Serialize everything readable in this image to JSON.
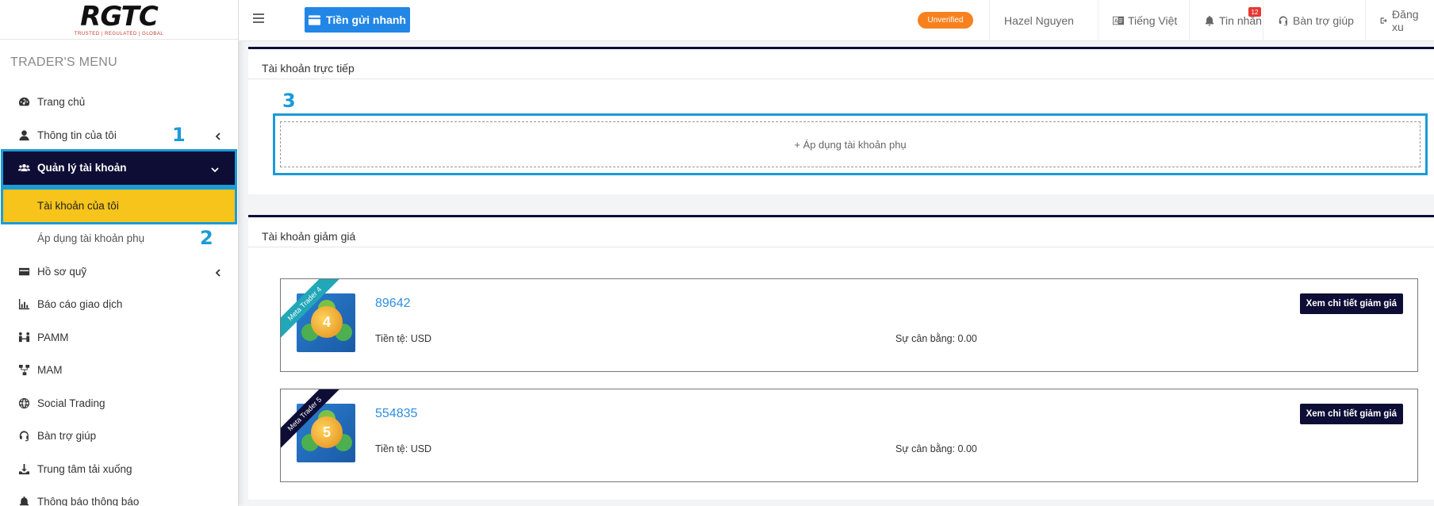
{
  "brand": {
    "logo_text": "RGTC",
    "logo_tagline": "TRUSTED | REGULATED | GLOBAL"
  },
  "sidebar": {
    "menu_title": "TRADER'S MENU",
    "items": [
      {
        "label": "Trang chủ",
        "icon": "dashboard-icon"
      },
      {
        "label": "Thông tin của tôi",
        "icon": "user-icon"
      },
      {
        "label": "Quản lý tài khoản",
        "icon": "users-icon"
      },
      {
        "label": "Tài khoản của tôi"
      },
      {
        "label": "Áp dụng tài khoản phụ"
      },
      {
        "label": "Hồ sơ quỹ",
        "icon": "credit-card-icon"
      },
      {
        "label": "Báo cáo giao dịch",
        "icon": "bar-chart-icon"
      },
      {
        "label": "PAMM",
        "icon": "pamm-icon"
      },
      {
        "label": "MAM",
        "icon": "network-icon"
      },
      {
        "label": "Social Trading",
        "icon": "globe-icon"
      },
      {
        "label": "Bàn trợ giúp",
        "icon": "headset-icon"
      },
      {
        "label": "Trung tâm tải xuống",
        "icon": "download-icon"
      },
      {
        "label": "Thông báo thông báo",
        "icon": "bell-icon"
      }
    ],
    "markers": [
      "1",
      "2",
      "3"
    ]
  },
  "topbar": {
    "deposit_label": "Tiền gửi nhanh",
    "status_badge": "Unverified",
    "user_name": "Hazel Nguyen",
    "language": "Tiếng Việt",
    "messages_label": "Tin nhắn",
    "messages_count": "12",
    "support_label": "Bàn trợ giúp",
    "logout_label": "Đăng xu"
  },
  "live_accounts": {
    "title": "Tài khoản trực tiếp",
    "apply_label": "+ Áp dụng tài khoản phụ"
  },
  "rebate_accounts": {
    "title": "Tài khoản giảm giá",
    "accounts": [
      {
        "platform": "Meta Trader 4",
        "platform_num": "4",
        "number": "89642",
        "currency": "Tiền tệ: USD",
        "balance": "Sự cân bằng: 0.00",
        "button": "Xem chi tiết giảm giá"
      },
      {
        "platform": "Meta Trader 5",
        "platform_num": "5",
        "number": "554835",
        "currency": "Tiền tệ: USD",
        "balance": "Sự cân bằng: 0.00",
        "button": "Xem chi tiết giảm giá"
      }
    ]
  },
  "colors": {
    "navy": "#0e0d36",
    "highlight": "#f6c41a",
    "accent_blue": "#2286e6",
    "marker_blue": "#1b9bd7",
    "unverified_orange": "#f7811e"
  }
}
